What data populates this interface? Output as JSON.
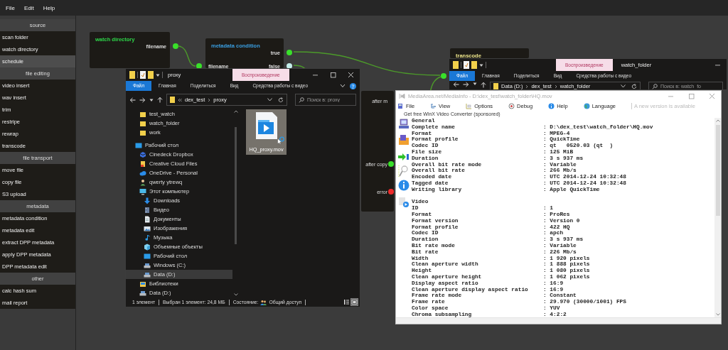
{
  "menu": [
    {
      "label": "File"
    },
    {
      "label": "Edit"
    },
    {
      "label": "Help"
    }
  ],
  "palette": [
    {
      "title": "source",
      "items": [
        {
          "label": "scan folder",
          "selected": false
        },
        {
          "label": "watch directory",
          "selected": false
        },
        {
          "label": "schedule",
          "selected": true
        }
      ]
    },
    {
      "title": "file editing",
      "items": [
        {
          "label": "video insert",
          "selected": false
        },
        {
          "label": "wav insert",
          "selected": false
        },
        {
          "label": "trim",
          "selected": false
        },
        {
          "label": "restripe",
          "selected": false
        },
        {
          "label": "rewrap",
          "selected": false
        },
        {
          "label": "transcode",
          "selected": false
        }
      ]
    },
    {
      "title": "file transport",
      "items": [
        {
          "label": "move file",
          "selected": false
        },
        {
          "label": "copy file",
          "selected": false
        },
        {
          "label": "S3 upload",
          "selected": false
        }
      ]
    },
    {
      "title": "metadata",
      "items": [
        {
          "label": "metadata condition",
          "selected": false
        },
        {
          "label": "metadata edit",
          "selected": false
        },
        {
          "label": "extract DPP metadata",
          "selected": false
        },
        {
          "label": "apply DPP metadata",
          "selected": false
        },
        {
          "label": "DPP metadata edit",
          "selected": false
        }
      ]
    },
    {
      "title": "other",
      "items": [
        {
          "label": "calc hash sum",
          "selected": false
        },
        {
          "label": "mail report",
          "selected": false
        }
      ]
    }
  ],
  "nodes": [
    {
      "title": "watch directory",
      "color": "#2ed84a",
      "outputs": [
        {
          "label": "filename",
          "color": "#39e02a"
        }
      ]
    },
    {
      "title": "metadata condition",
      "color": "#3a9ee0",
      "inputs": [
        {
          "label": "filename",
          "color": "#39e02a"
        }
      ],
      "outputs": [
        {
          "label": "true",
          "color": "#39e02a"
        },
        {
          "label": "false",
          "color": "#c4eeea"
        }
      ]
    },
    {
      "title": "transcode",
      "color": "#ece48a",
      "inputs": [
        {
          "color": "#39e02a"
        }
      ]
    }
  ],
  "side_node_ports": [
    {
      "label": "after m"
    },
    {
      "label": "after copy",
      "color": "#39e02a"
    },
    {
      "label": "error",
      "color": "#ee2a2a"
    }
  ],
  "explorers": [
    {
      "title": "proxy",
      "context_tab": "Воспроизведение",
      "ribbon": [
        {
          "label": "Файл",
          "selected": true
        },
        {
          "label": "Главная",
          "selected": false
        },
        {
          "label": "Поделиться",
          "selected": false
        },
        {
          "label": "Вид",
          "selected": false
        },
        {
          "label": "Средства работы с видео",
          "selected": false
        }
      ],
      "path": [
        "dex_test",
        "proxy"
      ],
      "search": {
        "placeholder": "Поиск в: proxy"
      },
      "nav_continued": [
        {
          "label": "test_watch",
          "kind": "folder",
          "selected": false
        },
        {
          "label": "watch_folder",
          "kind": "folder",
          "selected": false
        },
        {
          "label": "work",
          "kind": "folder",
          "selected": false
        }
      ],
      "nav_tree": [
        {
          "label": "Рабочий стол",
          "kind": "desktop",
          "selected": false,
          "children": [
            {
              "label": "Cinedeck Dropbox",
              "kind": "box",
              "selected": false
            },
            {
              "label": "Creative Cloud Files",
              "kind": "cloudfiles",
              "selected": false
            },
            {
              "label": "OneDrive - Personal",
              "kind": "cloud",
              "selected": false
            },
            {
              "label": "qwerty ytrewq",
              "kind": "user",
              "selected": false
            },
            {
              "label": "Этот компьютер",
              "kind": "pc",
              "selected": false,
              "children": [
                {
                  "label": "Downloads",
                  "kind": "download",
                  "selected": false
                },
                {
                  "label": "Видео",
                  "kind": "video",
                  "selected": false
                },
                {
                  "label": "Документы",
                  "kind": "docs",
                  "selected": false
                },
                {
                  "label": "Изображения",
                  "kind": "images",
                  "selected": false
                },
                {
                  "label": "Музыка",
                  "kind": "music",
                  "selected": false
                },
                {
                  "label": "Объемные объекты",
                  "kind": "cube",
                  "selected": false
                },
                {
                  "label": "Рабочий стол",
                  "kind": "desktop",
                  "selected": false
                },
                {
                  "label": "Windows (C:)",
                  "kind": "drive",
                  "selected": false
                },
                {
                  "label": "Data (D:)",
                  "kind": "drive",
                  "selected": true
                }
              ]
            },
            {
              "label": "Библиотеки",
              "kind": "library",
              "selected": false
            },
            {
              "label": "Data (D:)",
              "kind": "drive",
              "selected": false
            }
          ]
        }
      ],
      "files": [
        {
          "name": "HQ_proxy.mov",
          "selected": true
        }
      ],
      "status": [
        "1 элемент",
        "Выбран 1 элемент: 24,8 МБ"
      ],
      "share": {
        "label": "Состояние:",
        "value": "Общий доступ"
      },
      "view_modes": [
        {
          "kind": "details",
          "selected": false
        },
        {
          "kind": "tiles",
          "selected": true
        }
      ]
    },
    {
      "title": "watch_folder",
      "context_tab": "Воспроизведение",
      "ribbon": [
        {
          "label": "Файл",
          "selected": true
        },
        {
          "label": "Главная",
          "selected": false
        },
        {
          "label": "Поделиться",
          "selected": false
        },
        {
          "label": "Вид",
          "selected": false
        },
        {
          "label": "Средства работы с видео",
          "selected": false
        }
      ],
      "path": [
        "Data (D:)",
        "dex_test",
        "watch_folder"
      ],
      "search": {
        "placeholder": "Поиск в: watch_fo"
      }
    }
  ],
  "mediainfo": {
    "title": "MediaArea.net/MediaInfo - D:\\dex_test\\watch_folder\\HQ.mov",
    "menu": [
      {
        "label": "File",
        "kind": "file"
      },
      {
        "label": "View",
        "kind": "view"
      },
      {
        "label": "Options",
        "kind": "options"
      },
      {
        "label": "Debug",
        "kind": "debug"
      },
      {
        "label": "Help",
        "kind": "help"
      },
      {
        "label": "Language",
        "kind": "language"
      }
    ],
    "notice": "A new version is available",
    "sponsor": "Get free WinX Video Converter (sponsored)",
    "sections": [
      {
        "title": "General",
        "rows": [
          {
            "label": "Complete name",
            "value": ": D:\\dex_test\\watch_folder\\HQ.mov"
          },
          {
            "label": "Format",
            "value": ": MPEG-4"
          },
          {
            "label": "Format profile",
            "value": ": QuickTime"
          },
          {
            "label": "Codec ID",
            "value": ": qt   0520.03 (qt  )"
          },
          {
            "label": "File size",
            "value": ": 125 MiB"
          },
          {
            "label": "Duration",
            "value": ": 3 s 937 ms"
          },
          {
            "label": "Overall bit rate mode",
            "value": ": Variable"
          },
          {
            "label": "Overall bit rate",
            "value": ": 266 Mb/s"
          },
          {
            "label": "Encoded date",
            "value": ": UTC 2014-12-24 10:32:48"
          },
          {
            "label": "Tagged date",
            "value": ": UTC 2014-12-24 10:32:48"
          },
          {
            "label": "Writing library",
            "value": ": Apple QuickTime"
          }
        ]
      },
      {
        "title": "Video",
        "rows": [
          {
            "label": "ID",
            "value": ": 1"
          },
          {
            "label": "Format",
            "value": ": ProRes"
          },
          {
            "label": "Format version",
            "value": ": Version 0"
          },
          {
            "label": "Format profile",
            "value": ": 422 HQ"
          },
          {
            "label": "Codec ID",
            "value": ": apch"
          },
          {
            "label": "Duration",
            "value": ": 3 s 937 ms"
          },
          {
            "label": "Bit rate mode",
            "value": ": Variable"
          },
          {
            "label": "Bit rate",
            "value": ": 226 Mb/s"
          },
          {
            "label": "Width",
            "value": ": 1 920 pixels"
          },
          {
            "label": "Clean aperture width",
            "value": ": 1 888 pixels"
          },
          {
            "label": "Height",
            "value": ": 1 080 pixels"
          },
          {
            "label": "Clean aperture height",
            "value": ": 1 062 pixels"
          },
          {
            "label": "Display aspect ratio",
            "value": ": 16:9"
          },
          {
            "label": "Clean aperture display aspect ratio",
            "value": ": 16:9"
          },
          {
            "label": "Frame rate mode",
            "value": ": Constant"
          },
          {
            "label": "Frame rate",
            "value": ": 29.970 (30000/1001) FPS"
          },
          {
            "label": "Color space",
            "value": ": YUV"
          },
          {
            "label": "Chroma subsampling",
            "value": ": 4:2:2"
          }
        ]
      }
    ]
  }
}
